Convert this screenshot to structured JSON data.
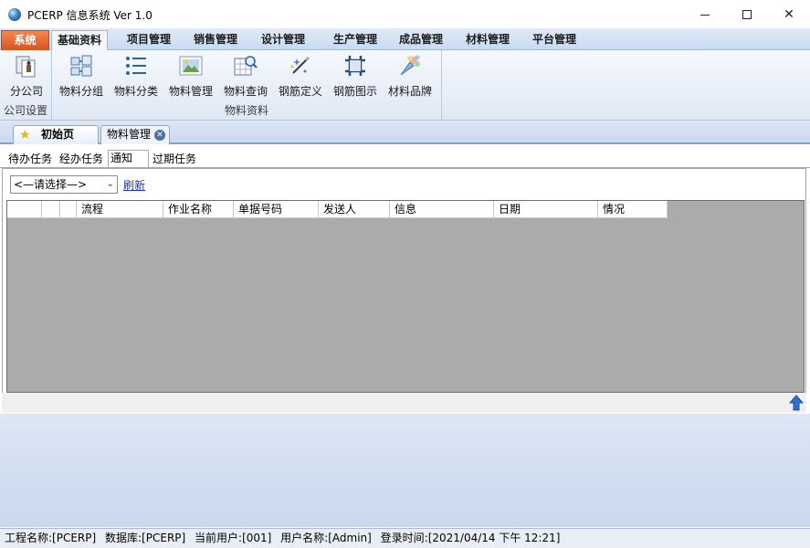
{
  "window": {
    "title": "PCERP 信息系统 Ver 1.0",
    "controls": {
      "minimize": "minimize",
      "maximize": "maximize",
      "close": "✕"
    }
  },
  "menu": {
    "system": "系统",
    "tabs": [
      "基础资料",
      "项目管理",
      "销售管理",
      "设计管理",
      "生产管理",
      "成品管理",
      "材料管理",
      "平台管理"
    ],
    "active": "基础资料"
  },
  "ribbon": {
    "groups": [
      {
        "label": "公司设置",
        "buttons": [
          {
            "label": "分公司",
            "icon": "branch-company-icon"
          }
        ]
      },
      {
        "label": "物料资料",
        "buttons": [
          {
            "label": "物料分组",
            "icon": "material-group-icon"
          },
          {
            "label": "物料分类",
            "icon": "material-category-icon"
          },
          {
            "label": "物料管理",
            "icon": "material-manage-icon"
          },
          {
            "label": "物料查询",
            "icon": "material-query-icon"
          },
          {
            "label": "钢筋定义",
            "icon": "rebar-define-icon"
          },
          {
            "label": "钢筋图示",
            "icon": "rebar-diagram-icon"
          },
          {
            "label": "材料品牌",
            "icon": "material-brand-icon"
          }
        ]
      }
    ]
  },
  "doc_tabs": {
    "home": "初始页",
    "material": "物料管理"
  },
  "subtabs": [
    "待办任务",
    "经办任务",
    "通知",
    "过期任务"
  ],
  "subtab_active": "通知",
  "filter": {
    "select_value": "<—请选择—>",
    "refresh_label": "刷新"
  },
  "grid": {
    "columns": [
      "",
      "",
      "",
      "流程",
      "作业名称",
      "单据号码",
      "发送人",
      "信息",
      "日期",
      "情况"
    ],
    "rows": []
  },
  "status": {
    "project": "工程名称:[PCERP]",
    "database": "数据库:[PCERP]",
    "current_user": "当前用户:[001]",
    "user_name": "用户名称:[Admin]",
    "login_time": "登录时间:[2021/04/14 下午 12:21]"
  },
  "colors": {
    "system_tab": "#e8662c",
    "grid_bg": "#ababab",
    "accent": "#3b6fb6"
  }
}
